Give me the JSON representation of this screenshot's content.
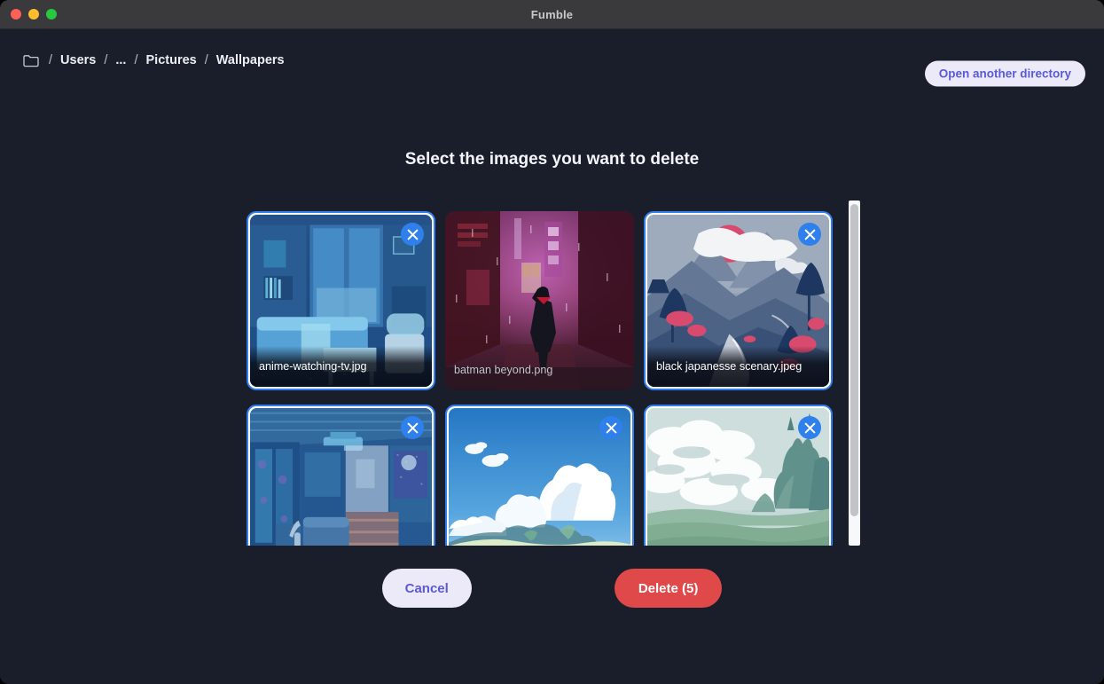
{
  "window": {
    "title": "Fumble",
    "traffic_lights": [
      "close-button",
      "minimize-button",
      "maximize-button"
    ]
  },
  "topbar": {
    "folder_icon": "folder-icon",
    "breadcrumb": [
      {
        "label": "Users"
      },
      {
        "label": "..."
      },
      {
        "label": "Pictures"
      },
      {
        "label": "Wallpapers"
      }
    ],
    "separator": "/",
    "open_directory_label": "Open another directory"
  },
  "main": {
    "heading": "Select the images you want to delete"
  },
  "gallery": {
    "remove_icon": "close-icon",
    "items": [
      {
        "filename": "anime-watching-tv.jpg",
        "selected": true,
        "thumb": "anime-bedroom-night"
      },
      {
        "filename": "batman beyond.png",
        "selected": false,
        "thumb": "cyberpunk-alley"
      },
      {
        "filename": "black japanesse scenary.jpeg",
        "selected": true,
        "thumb": "japanese-mountain-redsun"
      },
      {
        "filename": "",
        "selected": true,
        "thumb": "blue-japanese-room"
      },
      {
        "filename": "",
        "selected": true,
        "thumb": "blue-sky-clouds-field"
      },
      {
        "filename": "",
        "selected": true,
        "thumb": "green-hills-clouds"
      }
    ]
  },
  "actions": {
    "cancel_label": "Cancel",
    "delete_label": "Delete (5)",
    "selected_count": 5
  },
  "colors": {
    "app_background": "#1a1e2a",
    "titlebar": "#3a3a3c",
    "accent_indigo": "#5b5bd6",
    "accent_lavender_bg": "#eceaf8",
    "selection_blue": "#2f7ef0",
    "danger_red": "#e04949",
    "text_primary": "#f4f5f8"
  }
}
